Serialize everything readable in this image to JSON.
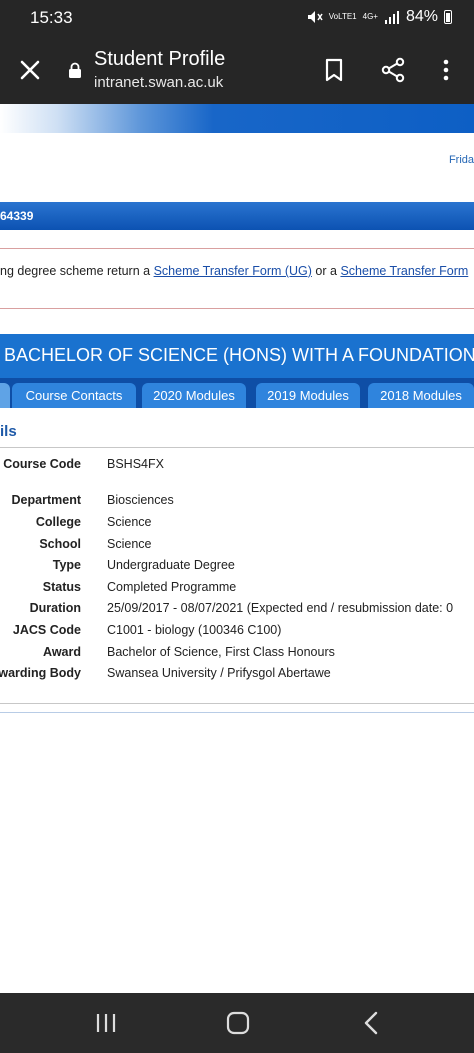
{
  "status_bar": {
    "time": "15:33",
    "signal_label": "VoLTE1",
    "network": "4G+",
    "battery": "84%"
  },
  "browser": {
    "title": "Student Profile",
    "url": "intranet.swan.ac.uk",
    "icons": [
      "close-icon",
      "lock-icon",
      "bookmark-icon",
      "share-icon",
      "more-icon"
    ]
  },
  "header": {
    "date_link": "Frida",
    "student_id": "64339"
  },
  "notice": {
    "prefix": "ng degree scheme return a ",
    "link1": "Scheme Transfer Form (UG)",
    "middle": " or a ",
    "link2": "Scheme Transfer Form"
  },
  "degree_title": "BACHELOR OF SCIENCE (HONS) WITH A FOUNDATION",
  "tabs": [
    {
      "label": "Course Contacts"
    },
    {
      "label": "2020 Modules"
    },
    {
      "label": "2019 Modules"
    },
    {
      "label": "2018 Modules"
    }
  ],
  "section_title": "ils",
  "details": [
    {
      "label": "Course Code",
      "value": "BSHS4FX"
    },
    {
      "label": "Department",
      "value": "Biosciences"
    },
    {
      "label": "College",
      "value": "Science"
    },
    {
      "label": "School",
      "value": "Science"
    },
    {
      "label": "Type",
      "value": "Undergraduate Degree"
    },
    {
      "label": "Status",
      "value": "Completed Programme"
    },
    {
      "label": "Duration",
      "value": "25/09/2017 - 08/07/2021 (Expected end / resubmission date: 0"
    },
    {
      "label": "JACS Code",
      "value": "C1001 - biology (100346 C100)"
    },
    {
      "label": "Award",
      "value": "Bachelor of Science, First Class Honours"
    },
    {
      "label": "warding Body",
      "value": "Swansea University / Prifysgol Abertawe"
    }
  ],
  "colors": {
    "toolbar_bg": "#262626",
    "banner_blue": "#0d5fc5",
    "degree_bar": "#1a72cf",
    "tab_bg": "#2f84dd",
    "link": "#1a4ea8"
  }
}
